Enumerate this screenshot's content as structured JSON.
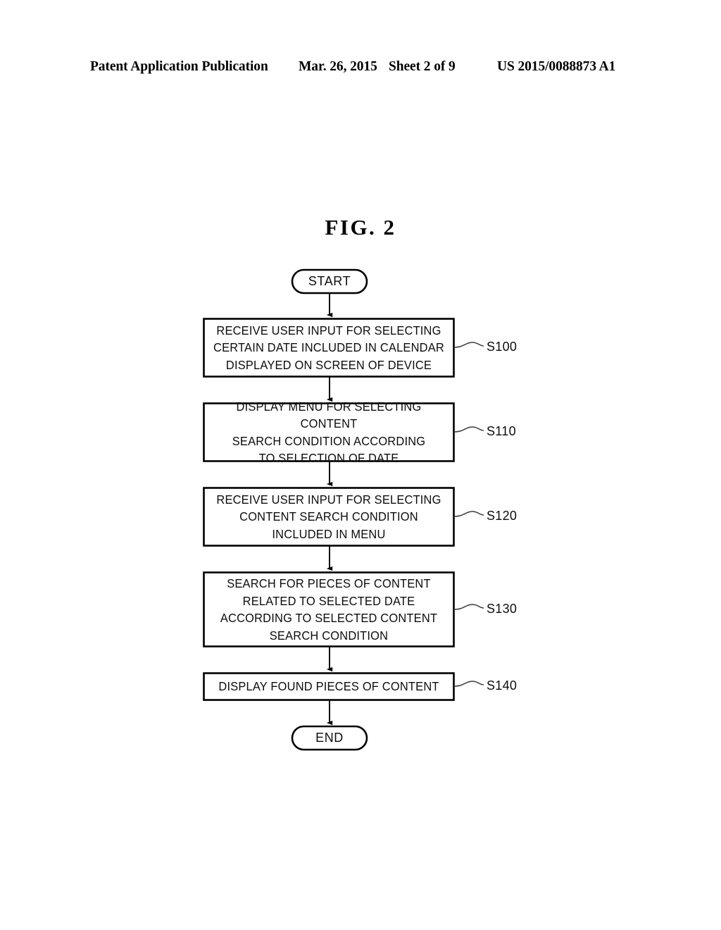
{
  "header": {
    "publication": "Patent Application Publication",
    "date": "Mar. 26, 2015",
    "sheet": "Sheet 2 of 9",
    "number": "US 2015/0088873 A1"
  },
  "figure": {
    "title": "FIG.  2"
  },
  "flowchart": {
    "start_label": "START",
    "end_label": "END",
    "steps": [
      {
        "id": "S100",
        "text": "RECEIVE USER INPUT FOR SELECTING\nCERTAIN DATE INCLUDED IN CALENDAR\nDISPLAYED ON SCREEN OF DEVICE"
      },
      {
        "id": "S110",
        "text": "DISPLAY MENU FOR SELECTING CONTENT\nSEARCH CONDITION ACCORDING\nTO SELECTION OF DATE"
      },
      {
        "id": "S120",
        "text": "RECEIVE USER INPUT FOR SELECTING\nCONTENT SEARCH CONDITION\nINCLUDED IN MENU"
      },
      {
        "id": "S130",
        "text": "SEARCH FOR PIECES OF CONTENT\nRELATED TO SELECTED DATE\nACCORDING TO SELECTED CONTENT\nSEARCH CONDITION"
      },
      {
        "id": "S140",
        "text": "DISPLAY FOUND PIECES OF CONTENT"
      }
    ]
  },
  "colors": {
    "ink": "#000000",
    "paper": "#ffffff"
  }
}
